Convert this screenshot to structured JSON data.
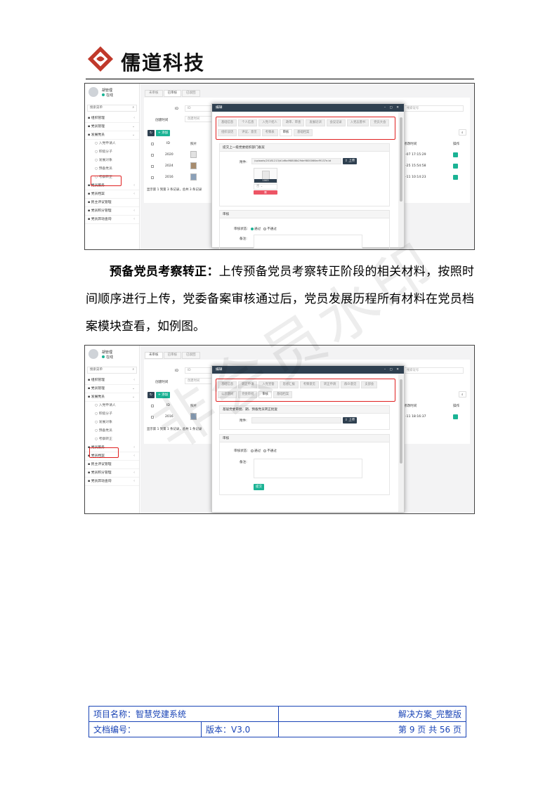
{
  "header": {
    "logo_text": "儒道科技",
    "brand_color": "#c0392b"
  },
  "screenshot1": {
    "user": {
      "name": "胡管理",
      "status": "在线"
    },
    "search_placeholder": "搜索菜单",
    "sidebar": [
      {
        "label": "组织管理",
        "arrow": "‹"
      },
      {
        "label": "党员管理",
        "arrow": "⌄"
      },
      {
        "label": "发展党员",
        "arrow": "⌄"
      },
      {
        "label": "入党申请人",
        "sub": true
      },
      {
        "label": "积极分子",
        "sub": true
      },
      {
        "label": "发展对象",
        "sub": true
      },
      {
        "label": "预备党员",
        "sub": true,
        "highlight": true
      },
      {
        "label": "考察转正",
        "sub": true
      },
      {
        "label": "党员服务",
        "arrow": "‹"
      },
      {
        "label": "党员档案",
        "arrow": "‹"
      },
      {
        "label": "民主评议管理"
      },
      {
        "label": "党员积分管理",
        "arrow": "‹"
      },
      {
        "label": "党员异动查询",
        "arrow": "‹"
      }
    ],
    "tabs": [
      "未审核",
      "已审核",
      "已驳回"
    ],
    "filter": {
      "id_label": "ID",
      "id_value": "ID",
      "time_label": "创建时间",
      "time_placeholder": "创建时间",
      "search_placeholder": "搜索证号"
    },
    "table_headers": [
      "ID",
      "照片",
      "修改时间",
      "操作"
    ],
    "rows": [
      {
        "id": "2020",
        "time": "-07 17:15:29"
      },
      {
        "id": "2024",
        "time": "-25 15:54:58"
      },
      {
        "id": "2016",
        "time": "-11 10:14:23"
      }
    ],
    "page_info": "显示第 1 到第 3 条记录，总共 3 条记录",
    "add_button": "添加",
    "modal": {
      "title": "编辑",
      "tabs": [
        "基础信息",
        "个人信息",
        "入党介绍人",
        "政审、审查",
        "发展培训",
        "会议记录",
        "入党志愿书",
        "党员大会",
        "组织谈话",
        "评议、意见",
        "考察表",
        "审核",
        "基础档案"
      ],
      "active_tab": "审核",
      "section1_title": "提交上一级党委组织部门备案",
      "attach_label": "附件:",
      "attach_value": "/uploads/20181213/d1dfbd98808b29de9800066ecf9137e.bt",
      "upload_button": "上传",
      "file_name": "1003",
      "select_value": "否",
      "delete_button": "删",
      "section2_title": "审核",
      "status_label": "审核状态:",
      "pass": "通过",
      "reject": "不通过",
      "remark_label": "备注:"
    }
  },
  "paragraph": {
    "bold": "预备党员考察转正：",
    "text": "上传预备党员考察转正阶段的相关材料，按照时间顺序进行上传，党委备案审核通过后，党员发展历程所有材料在党员档案模块查看，如例图。"
  },
  "screenshot2": {
    "user": {
      "name": "胡管理",
      "status": "在线"
    },
    "search_placeholder": "搜索菜单",
    "sidebar": [
      {
        "label": "组织管理",
        "arrow": "‹"
      },
      {
        "label": "党员管理",
        "arrow": "⌄"
      },
      {
        "label": "发展党员",
        "arrow": "⌄"
      },
      {
        "label": "入党申请人",
        "sub": true
      },
      {
        "label": "积极分子",
        "sub": true
      },
      {
        "label": "发展对象",
        "sub": true
      },
      {
        "label": "预备党员",
        "sub": true
      },
      {
        "label": "考察转正",
        "sub": true,
        "highlight": true
      },
      {
        "label": "党员服务",
        "arrow": "‹"
      },
      {
        "label": "党员档案",
        "arrow": "‹"
      },
      {
        "label": "民主评议管理"
      },
      {
        "label": "党员积分管理",
        "arrow": "‹"
      },
      {
        "label": "党员异动查询",
        "arrow": "‹"
      }
    ],
    "tabs": [
      "未审核",
      "已审核",
      "已驳回"
    ],
    "filter": {
      "id_label": "ID",
      "id_value": "ID",
      "time_label": "创建时间",
      "time_placeholder": "创建时间",
      "search_placeholder": "搜索证号"
    },
    "table_headers": [
      "ID",
      "照片",
      "修改时间",
      "操作"
    ],
    "rows": [
      {
        "id": "2016",
        "time": "-11 18:16:37"
      }
    ],
    "page_info": "显示第 1 到第 1 条记录，总共 1 条记录",
    "add_button": "添加",
    "modal": {
      "title": "编辑",
      "tabs": [
        "基础信息",
        "转正申请",
        "入党宣誓",
        "思想汇报",
        "考察意见",
        "转正申请",
        "群众意见",
        "支部会",
        "公示期间",
        "党委审批",
        "审核",
        "基础档案"
      ],
      "active_tab": "审核",
      "section1_title": "基层党委审批、期、预备党员转正批复",
      "attach_label": "附件:",
      "upload_button": "上传",
      "section2_title": "审核",
      "status_label": "审核状态:",
      "pass": "通过",
      "reject": "不通过",
      "remark_label": "备注:",
      "submit_button": "提交"
    }
  },
  "watermark": "非会员水印",
  "footer": {
    "project_label": "项目名称：智慧党建系统",
    "doc_type": "解决方案_完整版",
    "doc_no_label": "文档编号：",
    "version": "版本：V3.0",
    "page": "第 9 页 共 56 页"
  }
}
